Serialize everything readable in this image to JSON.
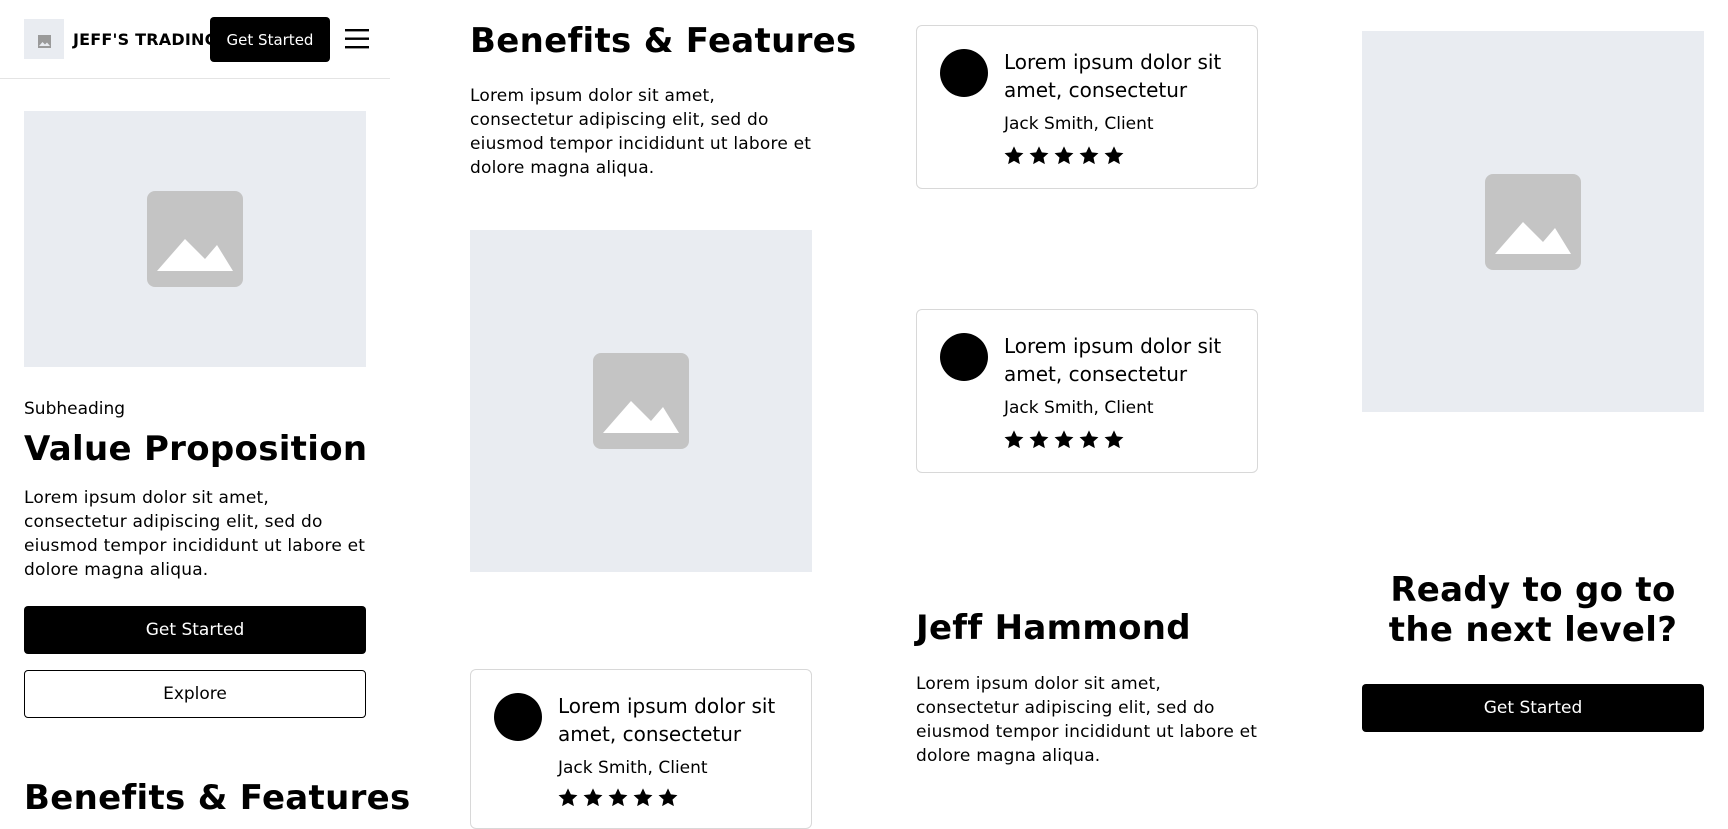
{
  "header": {
    "logo_icon": "image-placeholder-icon",
    "brand": "JEFF'S TRADING",
    "cta_label": "Get Started",
    "menu_icon": "hamburger-menu-icon"
  },
  "hero": {
    "subheading": "Subheading",
    "title": "Value Proposition",
    "body": "Lorem ipsum dolor sit amet, consectetur adipiscing elit, sed do eiusmod tempor incididunt ut labore et dolore magna aliqua.",
    "primary_button": "Get Started",
    "secondary_button": "Explore",
    "next_section_title": "Benefits & Features"
  },
  "benefits": {
    "title": "Benefits & Features",
    "body": "Lorem ipsum dolor sit amet, consectetur adipiscing elit, sed do eiusmod tempor incididunt ut labore et dolore magna aliqua."
  },
  "testimonials": [
    {
      "quote": "Lorem ipsum dolor sit amet, consectetur",
      "author": "Jack Smith, Client",
      "rating": 5
    },
    {
      "quote": "Lorem ipsum dolor sit amet, consectetur",
      "author": "Jack Smith, Client",
      "rating": 5
    },
    {
      "quote": "Lorem ipsum dolor sit amet, consectetur",
      "author": "Jack Smith, Client",
      "rating": 5
    }
  ],
  "profile": {
    "name": "Jeff Hammond",
    "body": "Lorem ipsum dolor sit amet, consectetur adipiscing elit, sed do eiusmod tempor incididunt ut labore et dolore magna aliqua."
  },
  "cta": {
    "title": "Ready to go to the next level?",
    "button": "Get Started"
  },
  "colors": {
    "primary": "#000000",
    "placeholder_bg": "#e9ecf1",
    "placeholder_icon": "#c4c4c4"
  }
}
